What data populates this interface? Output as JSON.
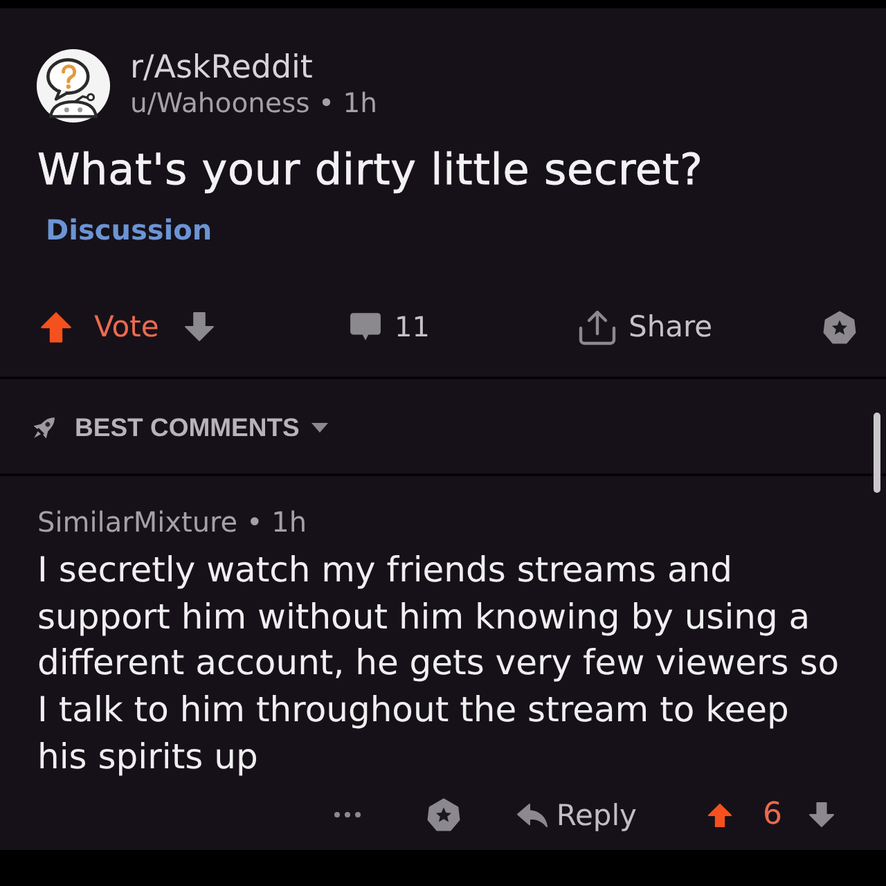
{
  "post": {
    "subreddit": "r/AskReddit",
    "byline": "u/Wahooness • 1h",
    "title": "What's your dirty little secret?",
    "flair": "Discussion"
  },
  "actions": {
    "vote_label": "Vote",
    "upvoted": true,
    "downvoted": false,
    "comment_count": "11",
    "share_label": "Share"
  },
  "sort": {
    "label": "BEST COMMENTS"
  },
  "comments": [
    {
      "meta": "SimilarMixture • 1h",
      "body": "I secretly watch my friends streams and support him without him knowing by using a different account, he gets very few viewers so I talk to him throughout the stream to keep his spirits up",
      "reply_label": "Reply",
      "score": "6",
      "upvoted": true,
      "downvoted": false
    }
  ]
}
